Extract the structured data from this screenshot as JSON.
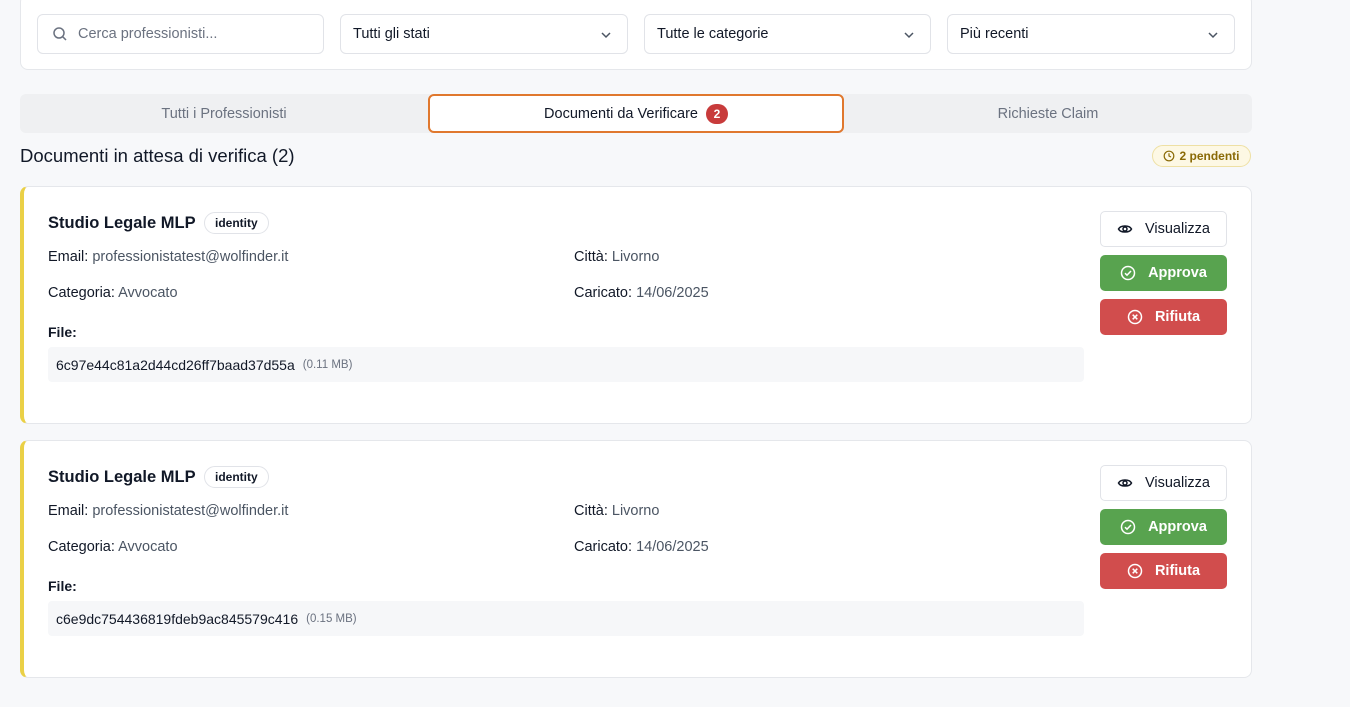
{
  "filters": {
    "search_placeholder": "Cerca professionisti...",
    "status": "Tutti gli stati",
    "category": "Tutte le categorie",
    "sort": "Più recenti"
  },
  "tabs": [
    {
      "label": "Tutti i Professionisti"
    },
    {
      "label": "Documenti da Verificare",
      "badge": "2"
    },
    {
      "label": "Richieste Claim"
    }
  ],
  "section": {
    "title": "Documenti in attesa di verifica (2)",
    "pending": "2 pendenti"
  },
  "labels": {
    "email": "Email:",
    "city": "Città:",
    "category": "Categoria:",
    "uploaded": "Caricato:",
    "file": "File:",
    "view": "Visualizza",
    "approve": "Approva",
    "reject": "Rifiuta"
  },
  "documents": [
    {
      "name": "Studio Legale MLP",
      "type": "identity",
      "email": "professionistatest@wolfinder.it",
      "city": "Livorno",
      "category": "Avvocato",
      "uploaded": "14/06/2025",
      "file_name": "6c97e44c81a2d44cd26ff7baad37d55a",
      "file_size": "(0.11 MB)"
    },
    {
      "name": "Studio Legale MLP",
      "type": "identity",
      "email": "professionistatest@wolfinder.it",
      "city": "Livorno",
      "category": "Avvocato",
      "uploaded": "14/06/2025",
      "file_name": "c6e9dc754436819fdeb9ac845579c416",
      "file_size": "(0.15 MB)"
    }
  ],
  "colors": {
    "accent_tab_border": "#e0782e",
    "card_stripe": "#ead046",
    "approve": "#58a34f",
    "reject": "#d14d4d",
    "badge_red": "#c83b3b"
  }
}
